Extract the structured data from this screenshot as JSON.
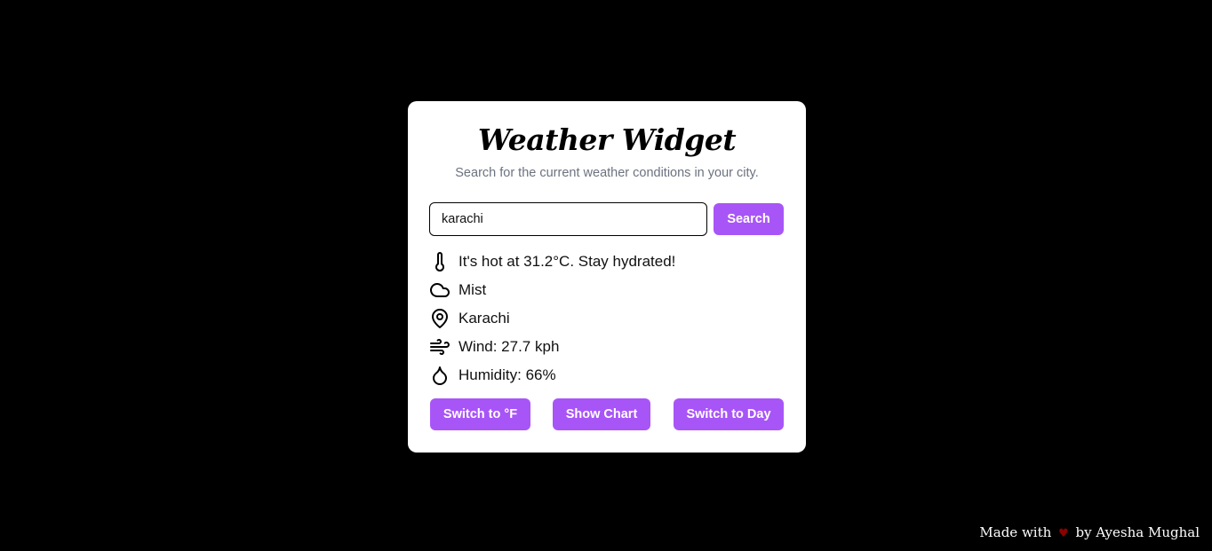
{
  "widget": {
    "title": "Weather Widget",
    "subtitle": "Search for the current weather conditions in your city."
  },
  "search": {
    "value": "karachi",
    "button_label": "Search"
  },
  "weather": {
    "temperature_text": "It's hot at 31.2°C. Stay hydrated!",
    "condition": "Mist",
    "location": "Karachi",
    "wind": "Wind: 27.7 kph",
    "humidity": "Humidity: 66%"
  },
  "actions": {
    "unit_label": "Switch to °F",
    "chart_label": "Show Chart",
    "mode_label": "Switch to Day"
  },
  "footer": {
    "prefix": "Made with",
    "heart": "♥",
    "suffix": "by Ayesha Mughal"
  },
  "colors": {
    "background": "#000000",
    "card": "#ffffff",
    "accent": "#a855f7",
    "subtitle": "#6b7280",
    "heart": "#8b0000"
  },
  "icons": [
    "thermometer-icon",
    "cloud-icon",
    "map-pin-icon",
    "wind-icon",
    "droplet-icon",
    "heart-icon"
  ]
}
